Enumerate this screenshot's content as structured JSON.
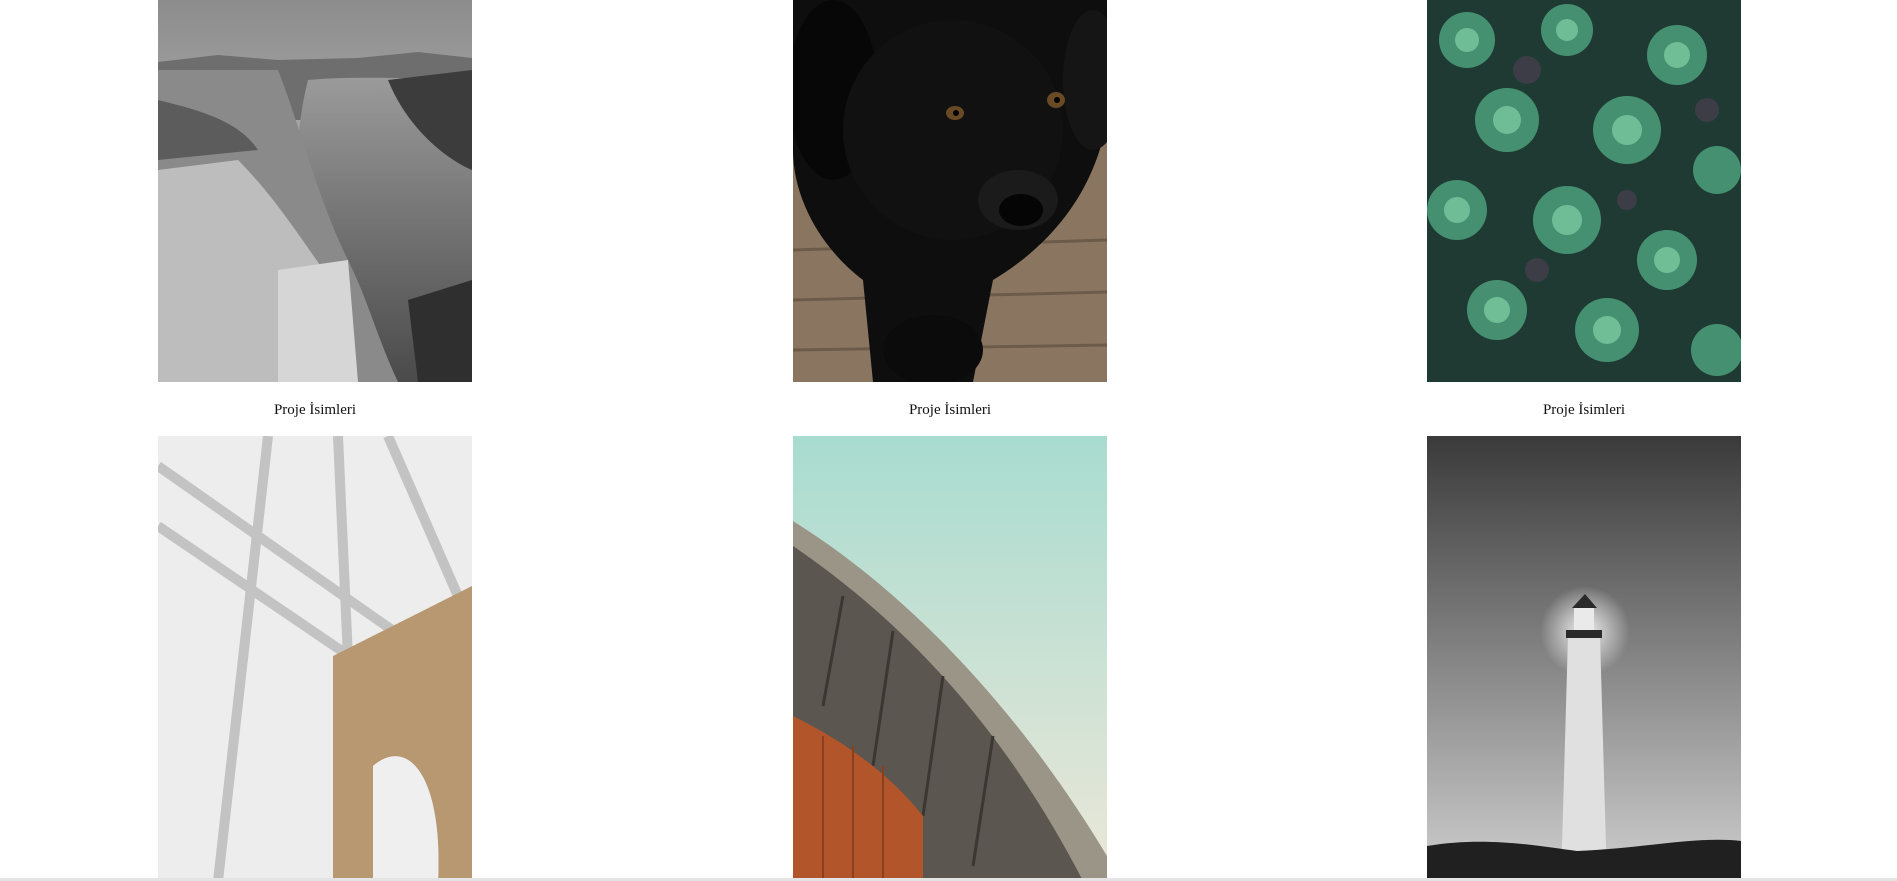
{
  "gallery": {
    "items": [
      {
        "image": "fjord-cliff-bw",
        "caption": "Proje İsimleri"
      },
      {
        "image": "black-puppy-on-deck",
        "caption": "Proje İsimleri"
      },
      {
        "image": "succulent-plants",
        "caption": "Proje İsimleri"
      },
      {
        "image": "bridge-cables-blurred",
        "caption": ""
      },
      {
        "image": "curved-building-roof",
        "caption": ""
      },
      {
        "image": "lighthouse-night-bw",
        "caption": ""
      }
    ]
  }
}
